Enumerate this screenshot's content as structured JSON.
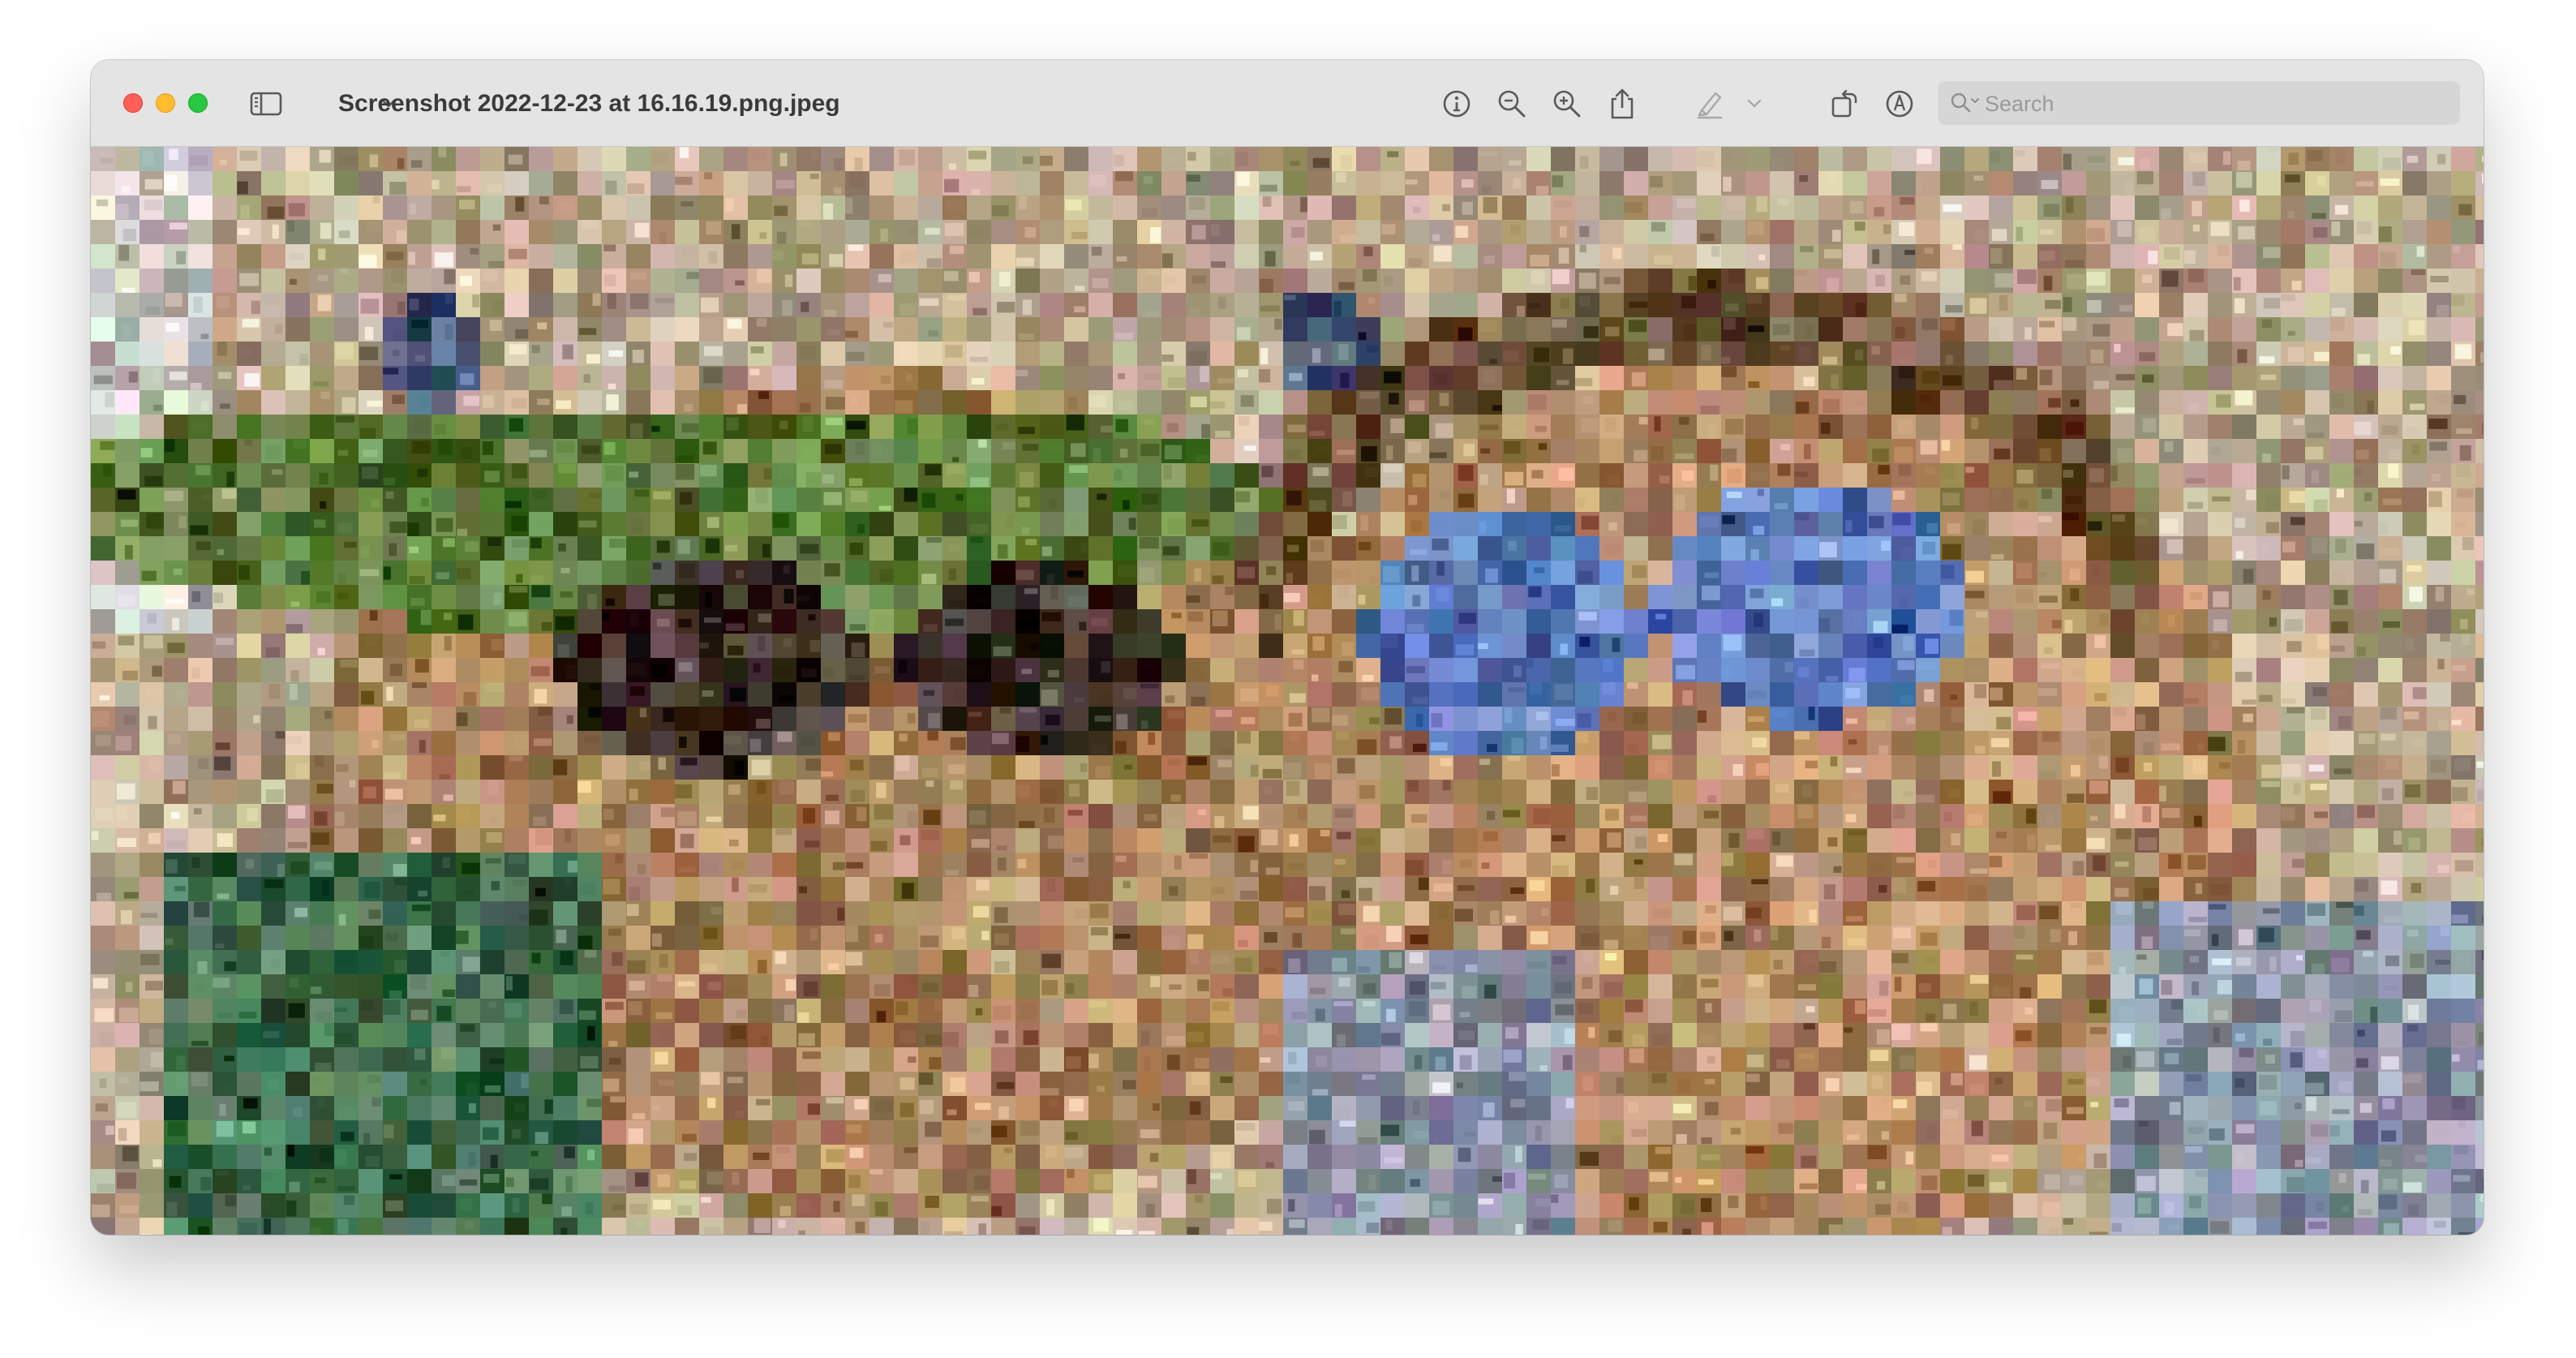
{
  "window": {
    "title": "Screenshot 2022-12-23 at 16.16.19.png.jpeg",
    "traffic_lights": {
      "close_color": "#ff5f57",
      "minimize_color": "#febc2e",
      "maximize_color": "#28c840"
    }
  },
  "toolbar": {
    "icons": {
      "sidebar": "sidebar-toggle-icon",
      "sidebar_menu": "chevron-down-icon",
      "info": "info-icon",
      "zoom_out": "zoom-out-icon",
      "zoom_in": "zoom-in-icon",
      "share": "share-icon",
      "highlight": "highlighter-icon",
      "highlight_menu": "chevron-down-icon",
      "rotate": "rotate-icon",
      "markup": "markup-pen-icon"
    },
    "search": {
      "placeholder": "Search",
      "value": ""
    }
  },
  "image": {
    "description_icon": "photo-mosaic-image",
    "palette": {
      "background": "#b7a58c",
      "skin": "#a8845e",
      "foliage": "#5f7a3c",
      "shadow": "#3b2e26",
      "glasses_blue": "#5a78b8",
      "sky": "#c9c7c0",
      "shirt_green": "#3f6a4a",
      "shirt_gray": "#8d96a6"
    }
  }
}
